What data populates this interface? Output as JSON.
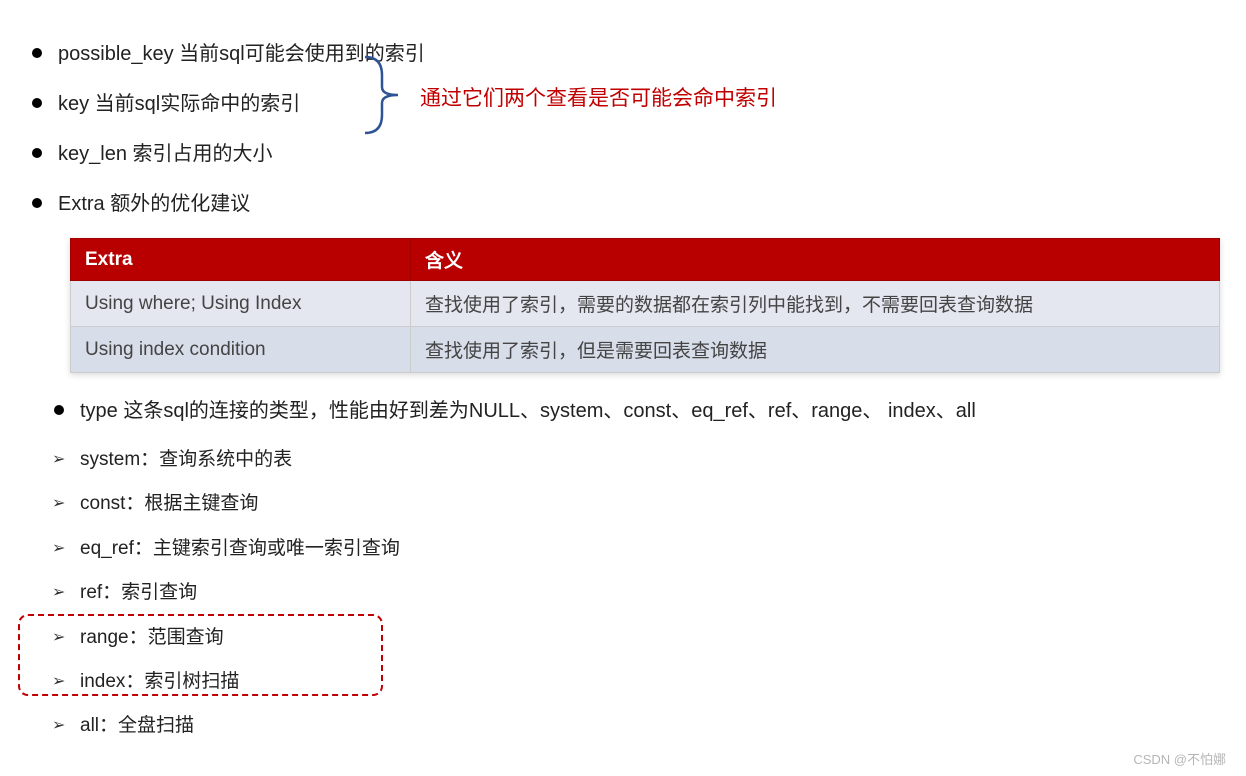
{
  "bullets": {
    "possible_key": "possible_key  当前sql可能会使用到的索引",
    "key": "key 当前sql实际命中的索引",
    "key_len": "key_len 索引占用的大小",
    "extra": "Extra 额外的优化建议",
    "type": "type 这条sql的连接的类型，性能由好到差为NULL、system、const、eq_ref、ref、range、 index、all"
  },
  "annotation": "通过它们两个查看是否可能会命中索引",
  "table": {
    "header": {
      "col1": "Extra",
      "col2": "含义"
    },
    "rows": [
      {
        "col1": "Using where; Using Index",
        "col2": "查找使用了索引，需要的数据都在索引列中能找到，不需要回表查询数据"
      },
      {
        "col1": "Using index condition",
        "col2": "查找使用了索引，但是需要回表查询数据"
      }
    ]
  },
  "sub_bullets": {
    "system": "system：查询系统中的表",
    "const": "const：根据主键查询",
    "eq_ref": "eq_ref：主键索引查询或唯一索引查询",
    "ref": "ref：索引查询",
    "range": "range：范围查询",
    "index": "index：索引树扫描",
    "all": "all：全盘扫描"
  },
  "watermark": "CSDN @不怕娜"
}
